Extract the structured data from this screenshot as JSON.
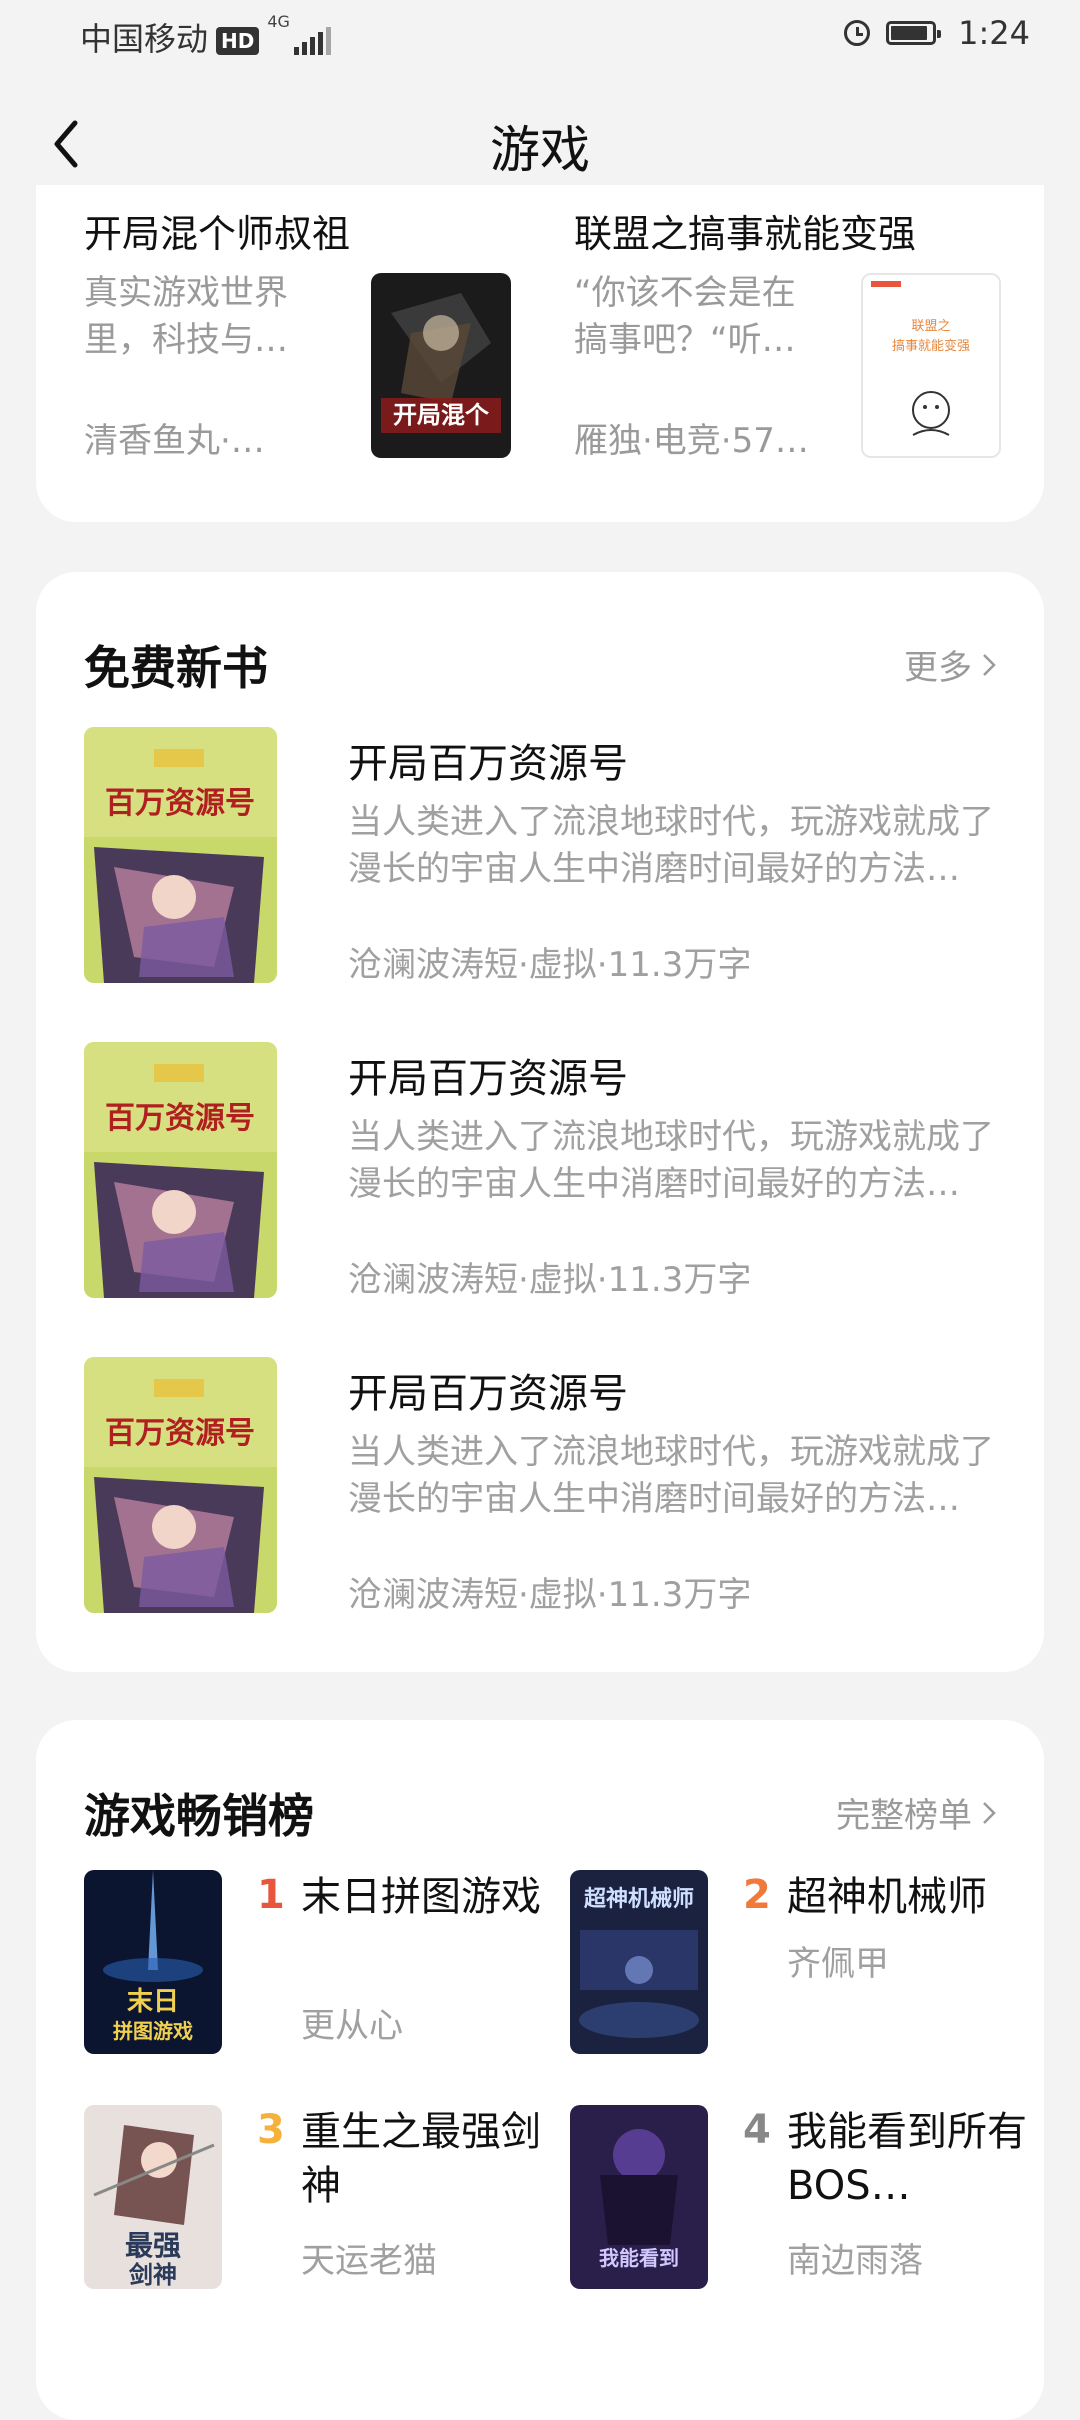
{
  "status_bar": {
    "carrier": "中国移动",
    "hd": "HD",
    "network": "4G",
    "time": "1:24"
  },
  "nav": {
    "title": "游戏"
  },
  "top_books": [
    {
      "title": "开局混个师叔祖",
      "desc": "真实游戏世界里，科技与…",
      "author": "清香鱼丸·…",
      "cover_icon": "book-cover-kaiju-hun"
    },
    {
      "title": "联盟之搞事就能变强",
      "desc": "“你该不会是在搞事吧？“听…",
      "author": "雁独·电竞·57…",
      "cover_icon": "book-cover-lianmeng"
    }
  ],
  "free_section": {
    "title": "免费新书",
    "more_label": "更多",
    "books": [
      {
        "title": "开局百万资源号",
        "desc": "当人类进入了流浪地球时代，玩游戏就成了漫长的宇宙人生中消磨时间最好的方法…",
        "meta": "沧澜波涛短·虚拟·11.3万字"
      },
      {
        "title": "开局百万资源号",
        "desc": "当人类进入了流浪地球时代，玩游戏就成了漫长的宇宙人生中消磨时间最好的方法…",
        "meta": "沧澜波涛短·虚拟·11.3万字"
      },
      {
        "title": "开局百万资源号",
        "desc": "当人类进入了流浪地球时代，玩游戏就成了漫长的宇宙人生中消磨时间最好的方法…",
        "meta": "沧澜波涛短·虚拟·11.3万字"
      }
    ]
  },
  "rank_section": {
    "title": "游戏畅销榜",
    "more_label": "完整榜单",
    "items": [
      {
        "rank": "1",
        "title": "末日拼图游戏",
        "author": "更从心",
        "rank_color": "#e8573d"
      },
      {
        "rank": "2",
        "title": "超神机械师",
        "author": "齐佩甲",
        "rank_color": "#f07a3a"
      },
      {
        "rank": "3",
        "title": "重生之最强剑神",
        "author": "天运老猫",
        "rank_color": "#f5b13a"
      },
      {
        "rank": "4",
        "title": "我能看到所有BOS…",
        "author": "南边雨落",
        "rank_color": "#888888"
      }
    ]
  },
  "colors": {
    "accent": "#e8573d",
    "secondary_text": "#9a9a9a",
    "background": "#f3f3f3"
  }
}
